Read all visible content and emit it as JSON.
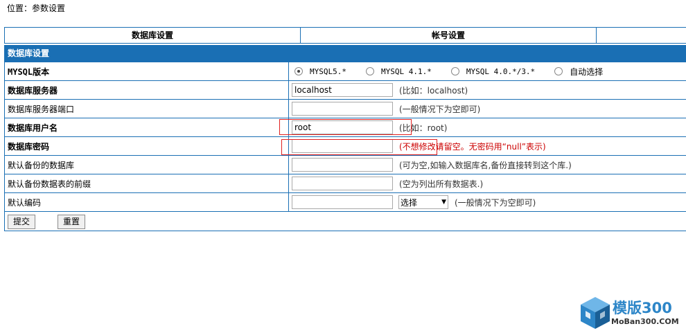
{
  "breadcrumb": "位置：参数设置",
  "tabs": [
    "数据库设置",
    "帐号设置"
  ],
  "section_title": "数据库设置",
  "fields": {
    "mysql_version": {
      "label": "MYSQL版本",
      "options": [
        "MYSQL5.*",
        "MYSQL 4.1.*",
        "MYSQL 4.0.*/3.*",
        "自动选择"
      ],
      "selected": "MYSQL5.*"
    },
    "db_server": {
      "label": "数据库服务器",
      "value": "localhost",
      "hint": "(比如：localhost)"
    },
    "db_port": {
      "label": "数据库服务器端口",
      "value": "",
      "hint": "(一般情况下为空即可)"
    },
    "db_user": {
      "label": "数据库用户名",
      "value": "root",
      "hint": "(比如：root)"
    },
    "db_password": {
      "label": "数据库密码",
      "value": "",
      "hint": "(不想修改请留空。无密码用“null”表示)"
    },
    "default_db": {
      "label": "默认备份的数据库",
      "value": "",
      "hint": "(可为空,如输入数据库名,备份直接转到这个库.)"
    },
    "table_prefix": {
      "label": "默认备份数据表的前缀",
      "value": "",
      "hint": "(空为列出所有数据表.)"
    },
    "charset": {
      "label": "默认编码",
      "value": "",
      "select": "选择",
      "hint": "(一般情况下为空即可)"
    }
  },
  "buttons": {
    "submit": "提交",
    "reset": "重置"
  },
  "watermark": {
    "title": "模版300",
    "sub": "MoBan300.COM",
    "color": "#2d86c8"
  },
  "colors": {
    "accent": "#1a6fb4",
    "highlight": "#e02020",
    "warning_text": "#cc0000"
  }
}
